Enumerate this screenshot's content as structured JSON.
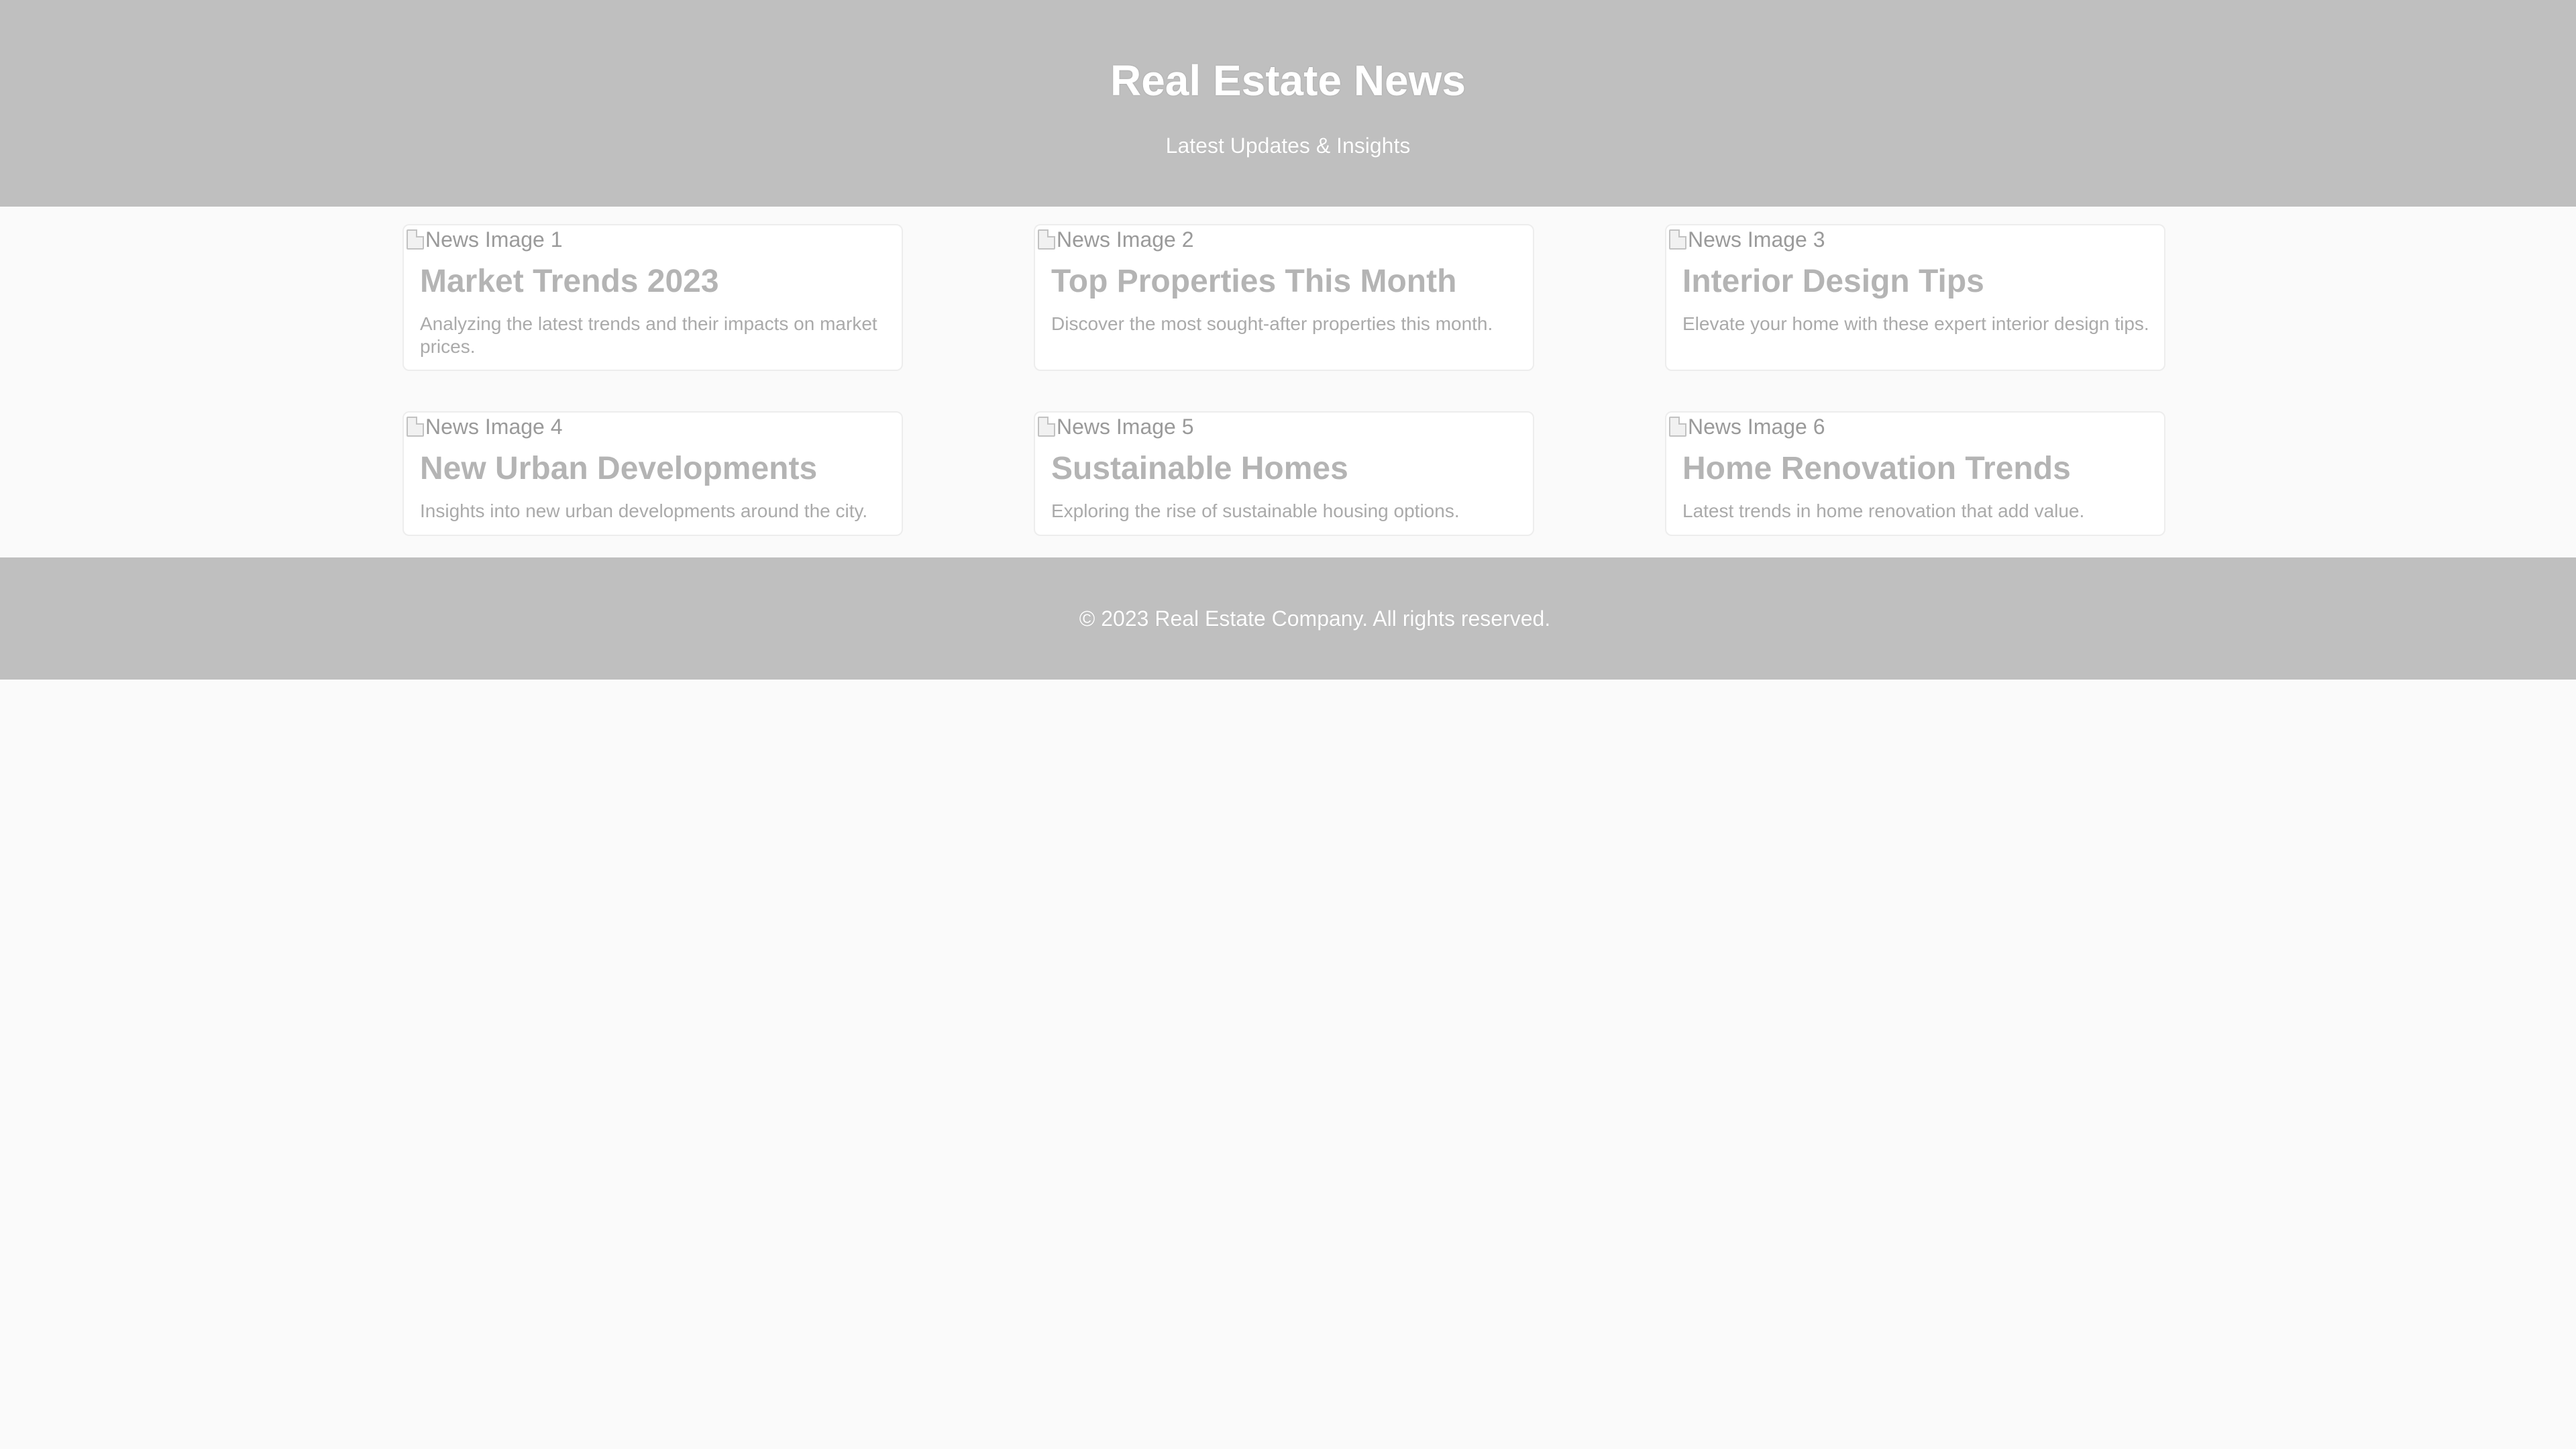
{
  "header": {
    "title": "Real Estate News",
    "subtitle": "Latest Updates & Insights"
  },
  "cards": [
    {
      "image_alt": "News Image 1",
      "title": "Market Trends 2023",
      "excerpt": "Analyzing the latest trends and their impacts on market prices."
    },
    {
      "image_alt": "News Image 2",
      "title": "Top Properties This Month",
      "excerpt": "Discover the most sought-after properties this month."
    },
    {
      "image_alt": "News Image 3",
      "title": "Interior Design Tips",
      "excerpt": "Elevate your home with these expert interior design tips."
    },
    {
      "image_alt": "News Image 4",
      "title": "New Urban Developments",
      "excerpt": "Insights into new urban developments around the city."
    },
    {
      "image_alt": "News Image 5",
      "title": "Sustainable Homes",
      "excerpt": "Exploring the rise of sustainable housing options."
    },
    {
      "image_alt": "News Image 6",
      "title": "Home Renovation Trends",
      "excerpt": "Latest trends in home renovation that add value."
    }
  ],
  "footer": {
    "copyright": "© 2023 Real Estate Company. All rights reserved."
  },
  "colors": {
    "header_background": "#bfbfbf",
    "page_background": "#fafafa",
    "card_background": "#ffffff",
    "header_text": "#ffffff"
  },
  "icons": {
    "card_image_placeholder": "broken-image-icon"
  }
}
